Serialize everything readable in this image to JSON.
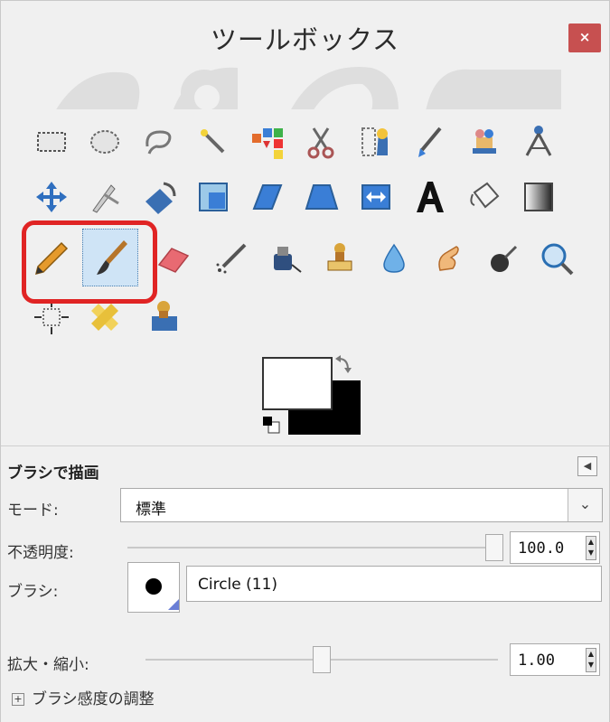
{
  "window": {
    "title": "ツールボックス",
    "close_label": "×",
    "accent_close": "#c75050"
  },
  "tools": [
    {
      "name": "rect-select-icon"
    },
    {
      "name": "ellipse-select-icon"
    },
    {
      "name": "free-select-icon"
    },
    {
      "name": "fuzzy-select-icon"
    },
    {
      "name": "select-by-color-icon"
    },
    {
      "name": "scissors-select-icon"
    },
    {
      "name": "foreground-select-icon"
    },
    {
      "name": "paths-icon"
    },
    {
      "name": "color-picker-icon"
    },
    {
      "name": "zoom-icon"
    },
    {
      "name": "move-icon"
    },
    {
      "name": "alignment-icon"
    },
    {
      "name": "rotate-icon"
    },
    {
      "name": "scale-icon"
    },
    {
      "name": "shear-icon"
    },
    {
      "name": "perspective-icon"
    },
    {
      "name": "flip-icon"
    },
    {
      "name": "text-icon"
    },
    {
      "name": "bucket-fill-icon"
    },
    {
      "name": "blend-icon"
    },
    {
      "name": "pencil-icon"
    },
    {
      "name": "paintbrush-icon",
      "active": true
    },
    {
      "name": "eraser-icon"
    },
    {
      "name": "airbrush-icon"
    },
    {
      "name": "ink-icon"
    },
    {
      "name": "clone-icon"
    },
    {
      "name": "blur-icon"
    },
    {
      "name": "smudge-icon"
    },
    {
      "name": "dodge-burn-icon"
    },
    {
      "name": "magnify-icon"
    },
    {
      "name": "crop-icon"
    },
    {
      "name": "heal-icon"
    },
    {
      "name": "perspective-clone-icon"
    }
  ],
  "colors": {
    "foreground": "#000000",
    "background": "#ffffff",
    "swap_icon": "swap-arrows-icon",
    "reset_icon": "default-colors-icon"
  },
  "options": {
    "title": "ブラシで描画",
    "menu_icon": "tab-menu-icon",
    "mode_label": "モード:",
    "mode_value": "標準",
    "opacity_label": "不透明度:",
    "opacity_value": "100.0",
    "opacity_level": 1.0,
    "brush_label": "ブラシ:",
    "brush_name": "Circle (11)",
    "scale_label": "拡大・縮小:",
    "scale_value": "1.00",
    "scale_level": 0.5,
    "expander_label": "ブラシ感度の調整"
  }
}
